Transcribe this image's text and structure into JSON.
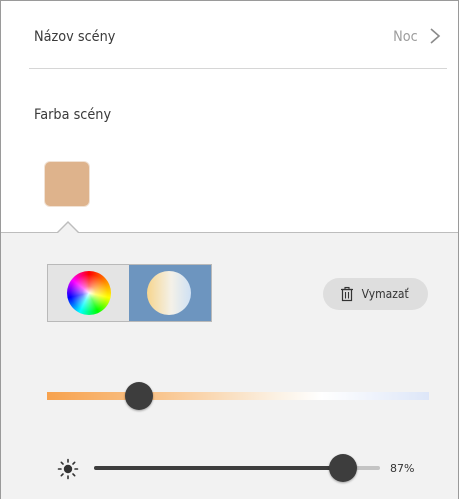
{
  "scene": {
    "name_label": "Názov scény",
    "name_value": "Noc",
    "color_label": "Farba scény",
    "swatch_color": "#deb38c"
  },
  "mode_toggle": {
    "options": [
      "color-wheel",
      "white-temperature"
    ],
    "selected": "white-temperature"
  },
  "clear_button": {
    "label": "Vymazať",
    "icon": "trash-icon"
  },
  "temperature_slider": {
    "value_fraction": 0.24
  },
  "brightness": {
    "icon": "sun-icon",
    "value_percent": 87,
    "label": "87%"
  },
  "colors": {
    "selected_mode_bg": "#6d95bf",
    "panel_bg": "#f2f2f2",
    "knob": "#3d3d3d"
  }
}
